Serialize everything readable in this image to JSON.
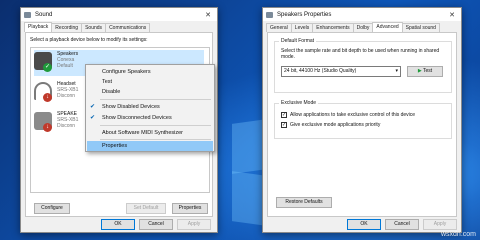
{
  "sound_window": {
    "title": "Sound",
    "tabs": [
      "Playback",
      "Recording",
      "Sounds",
      "Communications"
    ],
    "instruction": "Select a playback device below to modify its settings:",
    "devices": [
      {
        "name": "Speakers",
        "lines": [
          "Conexa",
          "Default"
        ],
        "status": "default"
      },
      {
        "name": "Headset",
        "lines": [
          "SRS-XB1",
          "Disconn"
        ],
        "status": "disconnected"
      },
      {
        "name": "SPEAKE",
        "lines": [
          "SRS-XB1",
          "Disconn"
        ],
        "status": "disconnected"
      }
    ],
    "buttons": {
      "configure": "Configure",
      "set_default": "Set Default",
      "properties": "Properties",
      "ok": "OK",
      "cancel": "Cancel",
      "apply": "Apply"
    }
  },
  "context_menu": {
    "items": [
      {
        "label": "Configure Speakers",
        "checked": false
      },
      {
        "label": "Test",
        "checked": false
      },
      {
        "label": "Disable",
        "checked": false
      },
      {
        "label": "Show Disabled Devices",
        "checked": true
      },
      {
        "label": "Show Disconnected Devices",
        "checked": true
      },
      {
        "label": "About Software MIDI Synthesizer",
        "checked": false
      },
      {
        "label": "Properties",
        "checked": false,
        "highlighted": true
      }
    ]
  },
  "props_window": {
    "title": "Speakers Properties",
    "tabs": [
      "General",
      "Levels",
      "Enhancements",
      "Dolby",
      "Advanced",
      "Spatial sound"
    ],
    "active_tab": "Advanced",
    "default_format": {
      "label": "Default Format",
      "description": "Select the sample rate and bit depth to be used when running in shared mode.",
      "selected": "24 bit, 44100 Hz (Studio Quality)",
      "test_label": "Test"
    },
    "exclusive_mode": {
      "label": "Exclusive Mode",
      "options": [
        {
          "label": "Allow applications to take exclusive control of this device",
          "checked": true
        },
        {
          "label": "Give exclusive mode applications priority",
          "checked": true
        }
      ]
    },
    "buttons": {
      "restore": "Restore Defaults",
      "ok": "OK",
      "cancel": "Cancel",
      "apply": "Apply"
    }
  },
  "watermark": "wsxdn.com",
  "colors": {
    "accent": "#0078d7",
    "highlight": "#91c9f7",
    "desktop": "#0e56b8"
  }
}
